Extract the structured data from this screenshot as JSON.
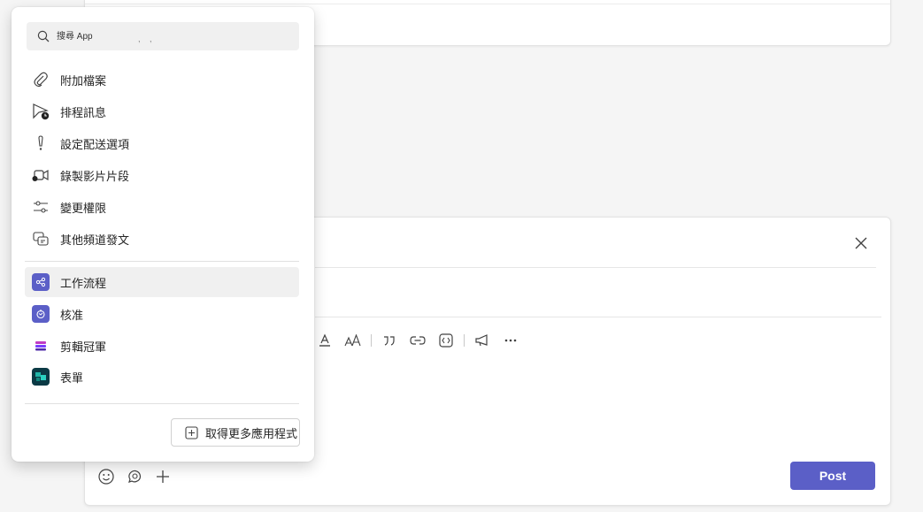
{
  "popup": {
    "search": {
      "placeholder": "搜尋 App",
      "hint": ", ,"
    },
    "actions": [
      {
        "label": "附加檔案",
        "icon": "paperclip-icon"
      },
      {
        "label": "排程訊息",
        "icon": "send-clock-icon"
      },
      {
        "label": "設定配送選項",
        "icon": "exclamation-icon"
      },
      {
        "label": "錄製影片片段",
        "icon": "video-clip-icon"
      },
      {
        "label": "變更權限",
        "icon": "sliders-icon"
      },
      {
        "label": "其他頻道發文",
        "icon": "multi-channel-icon"
      }
    ],
    "apps": [
      {
        "label": "工作流程",
        "icon": "workflows-app-icon",
        "color": "#5b5fc7"
      },
      {
        "label": "核准",
        "icon": "approvals-app-icon",
        "color": "#5b5fc7"
      },
      {
        "label": "剪輯冠軍",
        "icon": "clipchamp-app-icon",
        "color": "#7a3cff"
      },
      {
        "label": "表單",
        "icon": "forms-app-icon",
        "color": "#03787c"
      }
    ],
    "get_more_label": "取得更多應用程式"
  },
  "composer": {
    "post_label": "Post",
    "accent_color": "#5b5fc7",
    "format_tools": [
      "text-highlight-icon",
      "font-size-icon",
      "quote-icon",
      "link-icon",
      "code-snippet-icon",
      "announcement-icon",
      "more-options-icon"
    ],
    "bottom_tools": [
      "emoji-icon",
      "loop-icon",
      "plus-icon"
    ]
  }
}
